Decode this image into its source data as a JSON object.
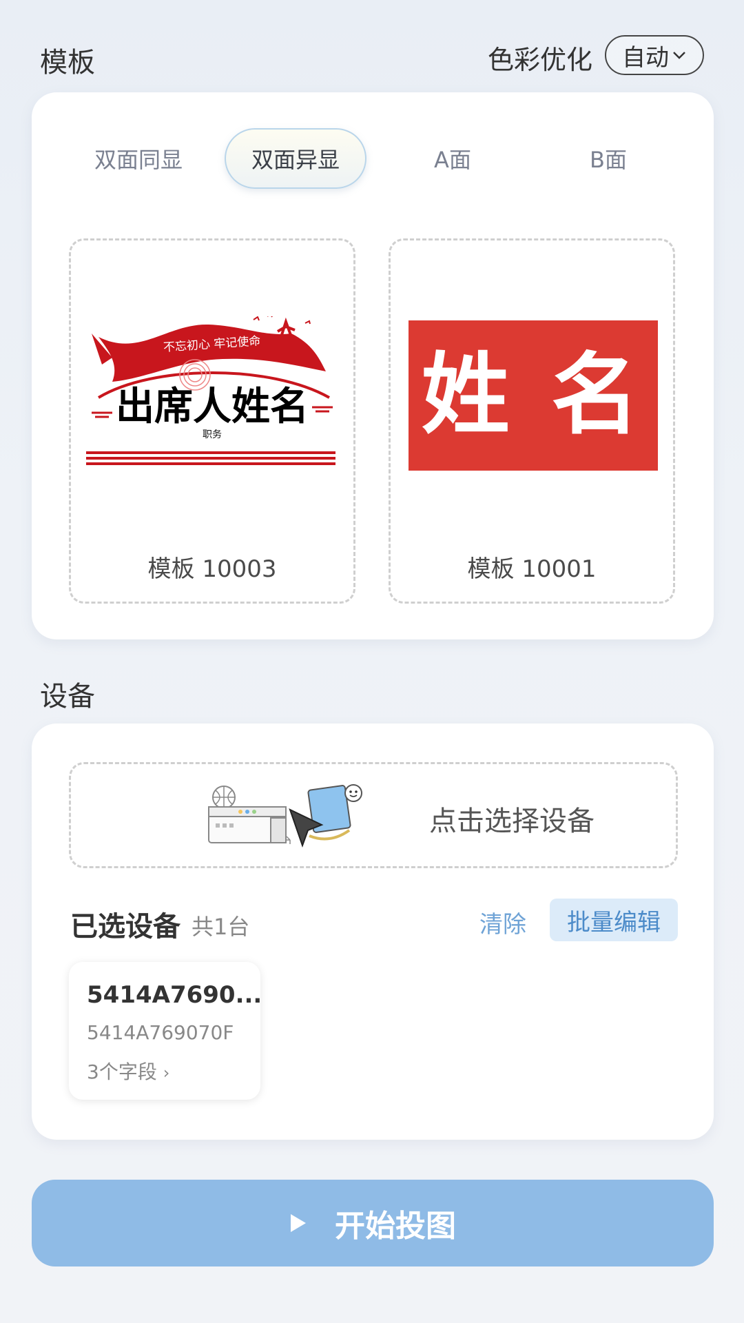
{
  "template_section": {
    "title": "模板",
    "color_optimize_label": "色彩优化",
    "color_optimize_value": "自动",
    "tabs": [
      {
        "label": "双面同显",
        "active": false
      },
      {
        "label": "双面异显",
        "active": true
      },
      {
        "label": "A面",
        "active": false
      },
      {
        "label": "B面",
        "active": false
      }
    ],
    "templates": [
      {
        "name": "模板 10003",
        "preview": {
          "banner_text": "不忘初心 牢记使命",
          "main_text": "出席人姓名",
          "sub_text": "职务"
        }
      },
      {
        "name": "模板 10001",
        "preview": {
          "main_text": "姓 名",
          "bg_color": "#dc3a32"
        }
      }
    ]
  },
  "device_section": {
    "title": "设备",
    "pick_label": "点击选择设备",
    "selected_title": "已选设备",
    "selected_count": "共1台",
    "clear_label": "清除",
    "batch_edit_label": "批量编辑",
    "devices": [
      {
        "title": "5414A7690...",
        "id": "5414A769070F",
        "fields": "3个字段"
      }
    ]
  },
  "start_button": {
    "label": "开始投图"
  },
  "colors": {
    "accent": "#6fa3d6",
    "start_bg": "#8fbbe6",
    "red": "#c8161d"
  }
}
